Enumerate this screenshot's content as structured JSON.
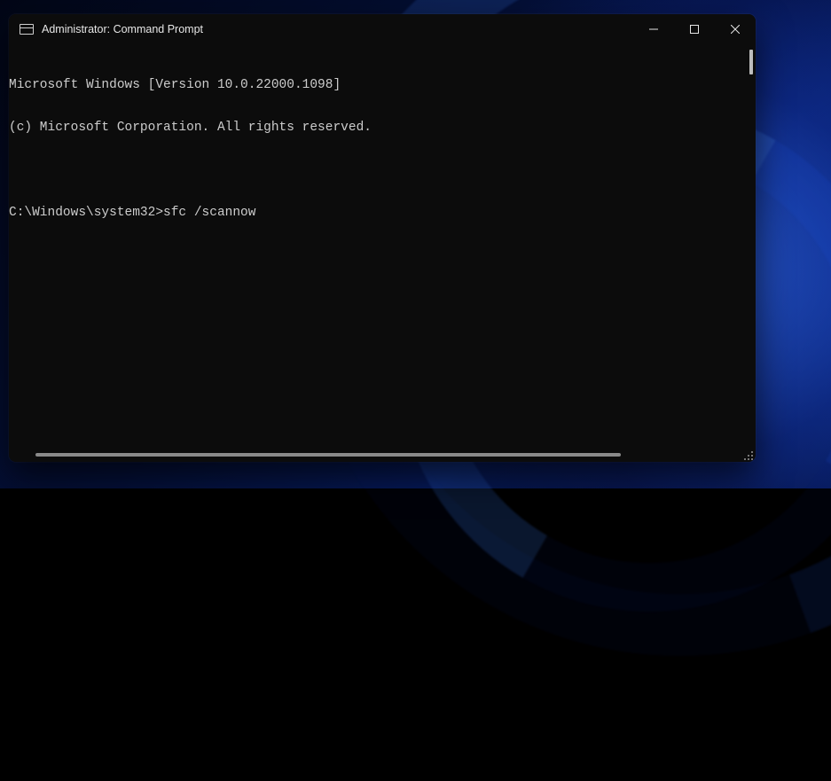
{
  "window": {
    "title": "Administrator: Command Prompt"
  },
  "terminal": {
    "line1": "Microsoft Windows [Version 10.0.22000.1098]",
    "line2": "(c) Microsoft Corporation. All rights reserved.",
    "prompt": "C:\\Windows\\system32>",
    "command": "sfc /scannow"
  }
}
